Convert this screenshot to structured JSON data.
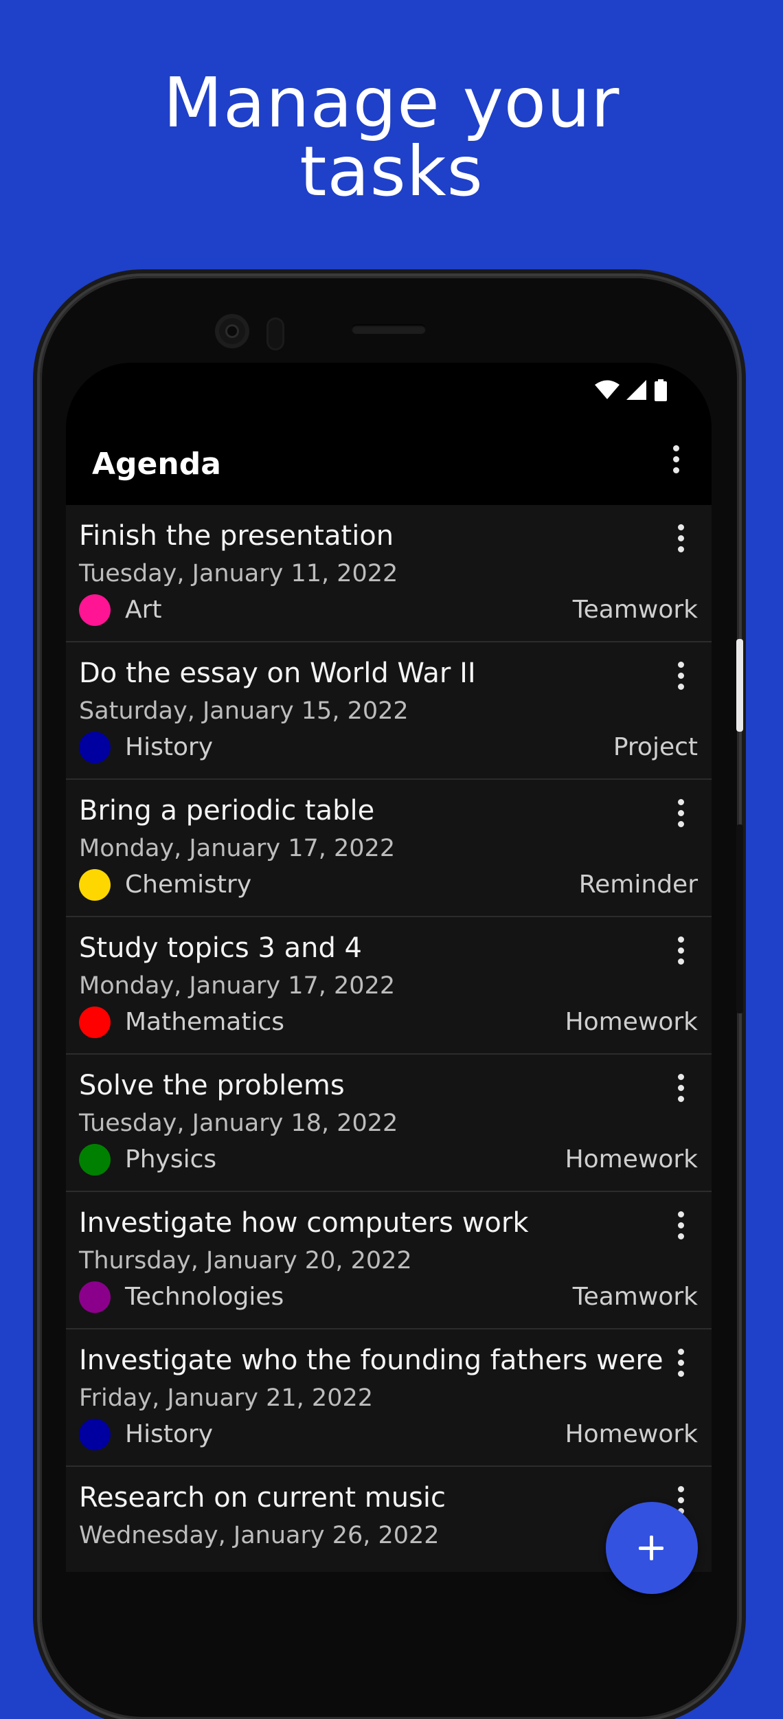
{
  "headline": {
    "line1": "Manage your",
    "line2": "tasks"
  },
  "app": {
    "title": "Agenda"
  },
  "icons": {
    "wifi": "wifi-icon",
    "signal": "cell-signal-icon",
    "battery": "battery-icon",
    "overflow": "more-vert-icon",
    "fab": "add-icon"
  },
  "tasks": [
    {
      "title": "Finish the presentation",
      "date": "Tuesday, January 11, 2022",
      "subject": "Art",
      "subject_color": "#ff1493",
      "type": "Teamwork"
    },
    {
      "title": "Do the essay on World War II",
      "date": "Saturday, January 15, 2022",
      "subject": "History",
      "subject_color": "#0000a0",
      "type": "Project"
    },
    {
      "title": "Bring a periodic table",
      "date": "Monday, January 17, 2022",
      "subject": "Chemistry",
      "subject_color": "#ffd700",
      "type": "Reminder"
    },
    {
      "title": "Study topics 3 and 4",
      "date": "Monday, January 17, 2022",
      "subject": "Mathematics",
      "subject_color": "#ff0000",
      "type": "Homework"
    },
    {
      "title": "Solve the problems",
      "date": "Tuesday, January 18, 2022",
      "subject": "Physics",
      "subject_color": "#008000",
      "type": "Homework"
    },
    {
      "title": "Investigate how computers work",
      "date": "Thursday, January 20, 2022",
      "subject": "Technologies",
      "subject_color": "#8b008b",
      "type": "Teamwork"
    },
    {
      "title": "Investigate who the founding fathers were",
      "date": "Friday, January 21, 2022",
      "subject": "History",
      "subject_color": "#0000a0",
      "type": "Homework"
    },
    {
      "title": "Research on current music",
      "date": "Wednesday, January 26, 2022",
      "subject": "",
      "subject_color": "",
      "type": ""
    }
  ],
  "colors": {
    "background": "#1f40c8",
    "fab": "#3452e0",
    "row": "#141414"
  }
}
